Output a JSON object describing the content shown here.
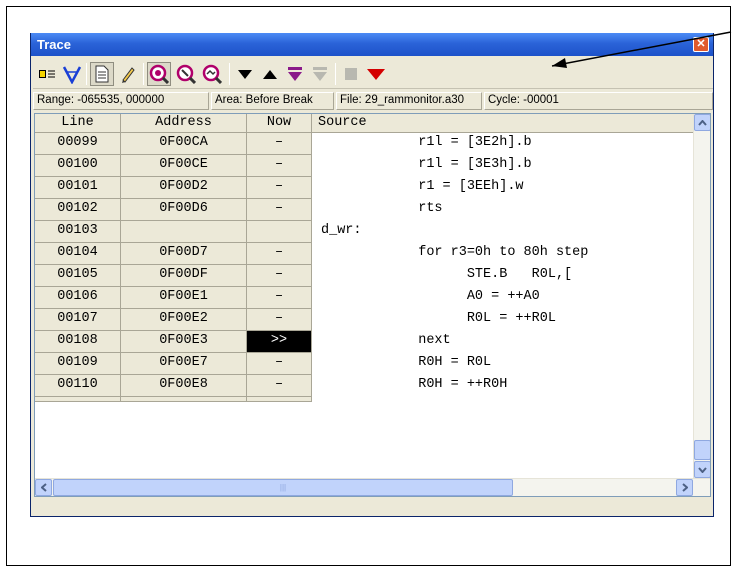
{
  "window": {
    "title": "Trace"
  },
  "toolbar": {
    "icons": [
      "trace-mark-icon",
      "filter-icon",
      "source-view-icon",
      "pencil-icon",
      "magnify-icon",
      "magnify-2-icon",
      "magnify-3-icon",
      "search-down-icon",
      "search-up-icon",
      "search-next-event-icon",
      "search-disabled-icon",
      "stop-disabled-icon",
      "restart-icon"
    ]
  },
  "infobar": {
    "range": "Range: -065535, 000000",
    "area": "Area: Before Break",
    "file": "File: 29_rammonitor.a30",
    "cycle": "Cycle: -00001"
  },
  "columns": {
    "line": "Line",
    "address": "Address",
    "now": "Now",
    "source": "Source"
  },
  "rows": [
    {
      "line": "00099",
      "address": "0F00CA",
      "now": "–",
      "source": "            r1l = [3E2h].b"
    },
    {
      "line": "00100",
      "address": "0F00CE",
      "now": "–",
      "source": "            r1l = [3E3h].b"
    },
    {
      "line": "00101",
      "address": "0F00D2",
      "now": "–",
      "source": "            r1 = [3EEh].w"
    },
    {
      "line": "00102",
      "address": "0F00D6",
      "now": "–",
      "source": "            rts"
    },
    {
      "line": "00103",
      "address": "",
      "now": "",
      "source": "d_wr:"
    },
    {
      "line": "00104",
      "address": "0F00D7",
      "now": "–",
      "source": "            for r3=0h to 80h step"
    },
    {
      "line": "00105",
      "address": "0F00DF",
      "now": "–",
      "source": "                  STE.B   R0L,["
    },
    {
      "line": "00106",
      "address": "0F00E1",
      "now": "–",
      "source": "                  A0 = ++A0"
    },
    {
      "line": "00107",
      "address": "0F00E2",
      "now": "–",
      "source": "                  R0L = ++R0L"
    },
    {
      "line": "00108",
      "address": "0F00E3",
      "now": ">>",
      "source": "            next"
    },
    {
      "line": "00109",
      "address": "0F00E7",
      "now": "–",
      "source": "            R0H = R0L"
    },
    {
      "line": "00110",
      "address": "0F00E8",
      "now": "–",
      "source": "            R0H = ++R0H"
    }
  ],
  "colors": {
    "titlebar": "#2a63d8",
    "window_bg": "#ece9d8",
    "arrow_red": "#cc0000"
  }
}
